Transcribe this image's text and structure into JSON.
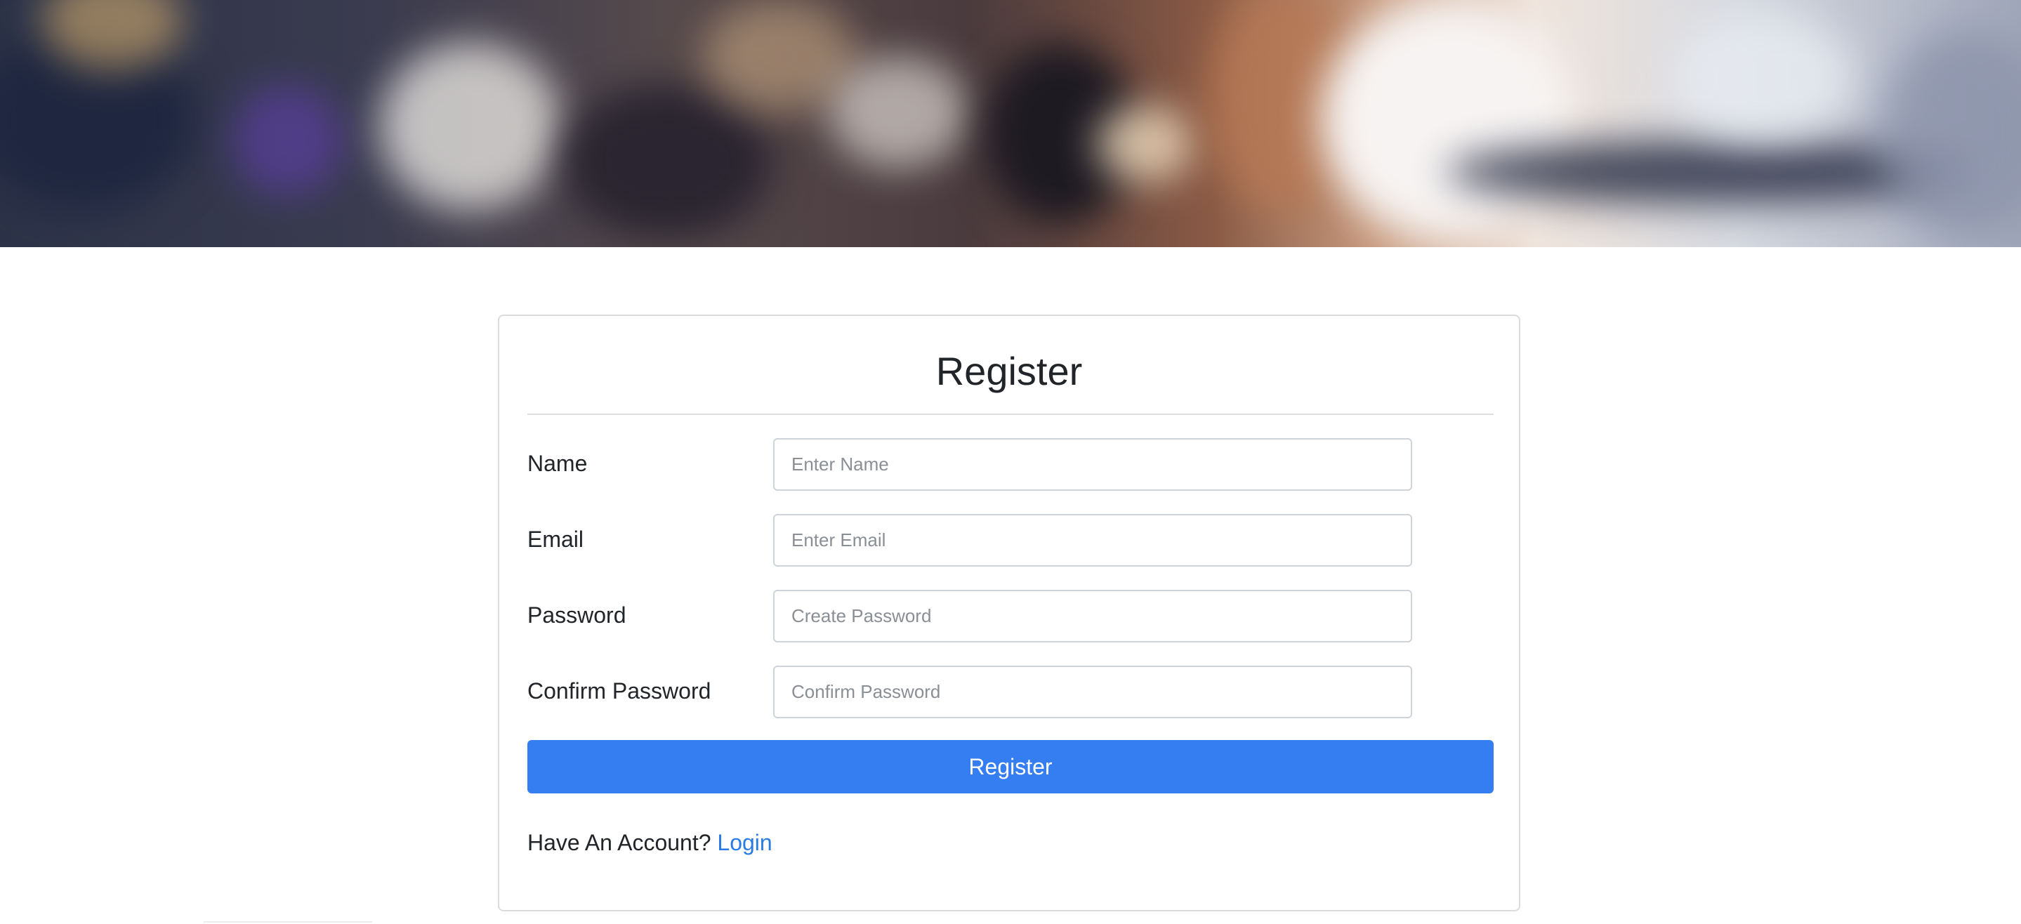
{
  "form": {
    "title": "Register",
    "fields": [
      {
        "label": "Name",
        "placeholder": "Enter Name",
        "value": ""
      },
      {
        "label": "Email",
        "placeholder": "Enter Email",
        "value": ""
      },
      {
        "label": "Password",
        "placeholder": "Create Password",
        "value": ""
      },
      {
        "label": "Confirm Password",
        "placeholder": "Confirm Password",
        "value": ""
      }
    ],
    "submit_label": "Register",
    "account_prompt": "Have An Account?",
    "login_link": "Login"
  },
  "colors": {
    "primary_button": "#357ef2",
    "link": "#2a7be4",
    "text": "#212529",
    "border": "#ced4da"
  }
}
